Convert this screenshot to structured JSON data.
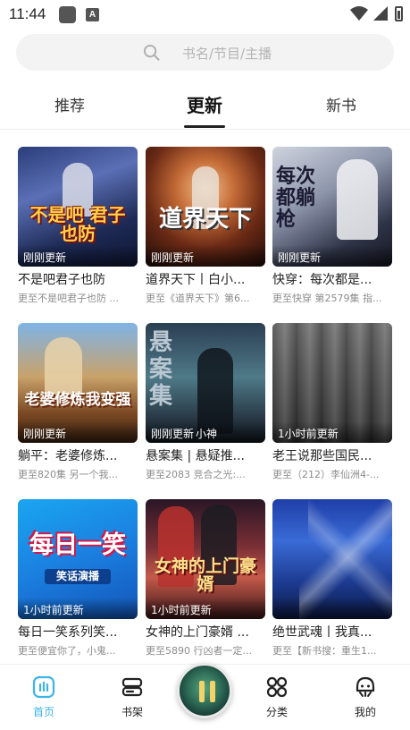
{
  "status_bar": {
    "time": "11:44",
    "badge_letter": "A"
  },
  "search": {
    "placeholder": "书名/节目/主播"
  },
  "tabs": [
    {
      "label": "推荐",
      "active": false
    },
    {
      "label": "更新",
      "active": true
    },
    {
      "label": "新书",
      "active": false
    }
  ],
  "cards": [
    {
      "cover_text": "不是吧 君子也防",
      "badge": "刚刚更新",
      "title": "不是吧君子也防",
      "subtitle": "更至不是吧君子也防 ..."
    },
    {
      "cover_text": "道界天下",
      "badge": "刚刚更新",
      "title": "道界天下丨白小...",
      "subtitle": "更至《道界天下》第6..."
    },
    {
      "cover_text": "每次都躺枪",
      "badge": "刚刚更新",
      "title": "快穿：每次都是...",
      "subtitle": "更至快穿 第2579集 指..."
    },
    {
      "cover_text": "老婆修炼我变强",
      "badge": "刚刚更新",
      "title": "躺平：老婆修炼...",
      "subtitle": "更至820集 另一个我..."
    },
    {
      "cover_text": "悬案集",
      "badge": "刚刚更新",
      "badge_extra": "小神",
      "title": "悬案集 | 悬疑推...",
      "subtitle": "更至2083 竞合之光:..."
    },
    {
      "cover_text": "",
      "badge": "1小时前更新",
      "title": "老王说那些国民...",
      "subtitle": "更至（212）李仙洲4-..."
    },
    {
      "cover_text": "每日一笑",
      "cover_sub": "笑话演播",
      "badge": "1小时前更新",
      "title": "每日一笑系列笑...",
      "subtitle": "更至便宜你了，小鬼..."
    },
    {
      "cover_text": "女神的上门豪婿",
      "badge": "1小时前更新",
      "title": "女神的上门豪婿 ...",
      "subtitle": "更至5890 行凶者一定..."
    },
    {
      "cover_text": "",
      "badge": "",
      "title": "绝世武魂丨我真...",
      "subtitle": "更至【新书搜：重生1..."
    }
  ],
  "bottom_nav": [
    {
      "label": "首页",
      "icon": "home-icon",
      "active": true
    },
    {
      "label": "书架",
      "icon": "bookshelf-icon",
      "active": false
    },
    {
      "label": "分类",
      "icon": "category-icon",
      "active": false
    },
    {
      "label": "我的",
      "icon": "profile-icon",
      "active": false
    }
  ],
  "colors": {
    "accent": "#3bb4e8",
    "search_bg": "#f3f3f3",
    "subtitle": "#8c8c8c"
  }
}
